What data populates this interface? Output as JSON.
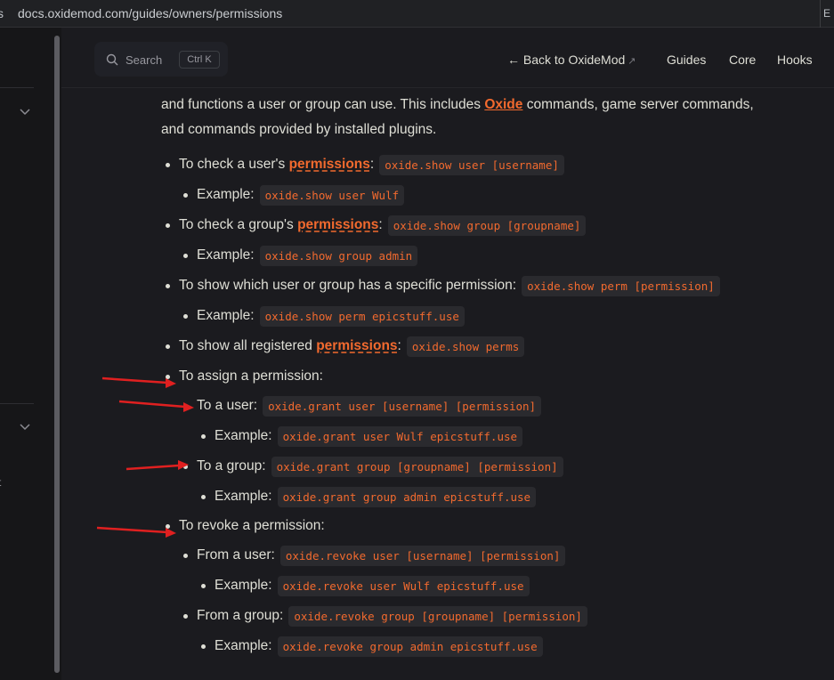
{
  "browser": {
    "url": "docs.oxidemod.com/guides/owners/permissions",
    "left_edge_glyph": "s",
    "right_edge_glyph": "E"
  },
  "sidebar": {
    "fragment": "t"
  },
  "header": {
    "search_label": "Search",
    "search_shortcut": "Ctrl K",
    "back_link": "← Back to OxideMod",
    "back_link_ext": "↗",
    "nav": [
      "Guides",
      "Core",
      "Hooks"
    ]
  },
  "intro": {
    "text_a": "and functions a user or group can use. This includes ",
    "link": "Oxide",
    "text_b": " commands, game server commands, and commands provided by installed plugins."
  },
  "items": [
    {
      "text": "To check a user's ",
      "link": "permissions",
      "after": ":",
      "code": "oxide.show user [username]"
    },
    {
      "text": "Example:",
      "code": "oxide.show user Wulf"
    },
    {
      "text": "To check a group's ",
      "link": "permissions",
      "after": ":",
      "code": "oxide.show group [groupname]"
    },
    {
      "text": "Example:",
      "code": "oxide.show group admin"
    },
    {
      "text": "To show which user or group has a specific permission:",
      "code": "oxide.show perm [permission]"
    },
    {
      "text": "Example:",
      "code": "oxide.show perm epicstuff.use"
    },
    {
      "text": "To show all registered ",
      "link": "permissions",
      "after": ":",
      "code": "oxide.show perms"
    },
    {
      "text": "To assign a permission:"
    },
    {
      "text": "To a user:",
      "code": "oxide.grant user [username] [permission]"
    },
    {
      "text": "Example:",
      "code": "oxide.grant user Wulf epicstuff.use"
    },
    {
      "text": "To a group:",
      "code": "oxide.grant group [groupname] [permission]"
    },
    {
      "text": "Example:",
      "code": "oxide.grant group admin epicstuff.use"
    },
    {
      "text": "To revoke a permission:"
    },
    {
      "text": "From a user:",
      "code": "oxide.revoke user [username] [permission]"
    },
    {
      "text": "Example:",
      "code": "oxide.revoke user Wulf epicstuff.use"
    },
    {
      "text": "From a group:",
      "code": "oxide.revoke group [groupname] [permission]"
    },
    {
      "text": "Example:",
      "code": "oxide.revoke group admin epicstuff.use"
    }
  ],
  "colors": {
    "accent": "#f26a2e",
    "annotation_arrow": "#e02020",
    "background": "#1b1b1f"
  }
}
